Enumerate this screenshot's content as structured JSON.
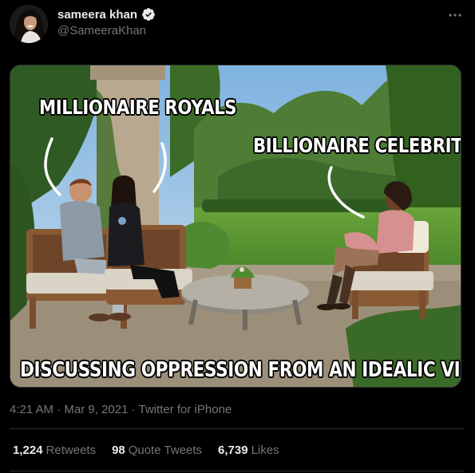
{
  "author": {
    "display_name": "sameera khan",
    "handle": "@SameeraKhan",
    "verified_icon": "verified-badge-icon",
    "avatar_icon": "avatar-photo"
  },
  "more_icon": "more-options-icon",
  "media": {
    "caption_top_left": "MILLIONAIRE ROYALS",
    "caption_top_right": "BILLIONAIRE CELEBRITY",
    "caption_bottom": "DISCUSSING OPPRESSION FROM AN IDEALIC VILLA"
  },
  "meta": {
    "time": "4:21 AM",
    "separator1": "·",
    "date": "Mar 9, 2021",
    "separator2": "·",
    "source": "Twitter for iPhone"
  },
  "stats": {
    "retweets_count": "1,224",
    "retweets_label": "Retweets",
    "quotes_count": "98",
    "quotes_label": "Quote Tweets",
    "likes_count": "6,739",
    "likes_label": "Likes"
  },
  "colors": {
    "background": "#000000",
    "primary_text": "#e7e9ea",
    "secondary_text": "#71767b",
    "divider": "#2f3336"
  }
}
